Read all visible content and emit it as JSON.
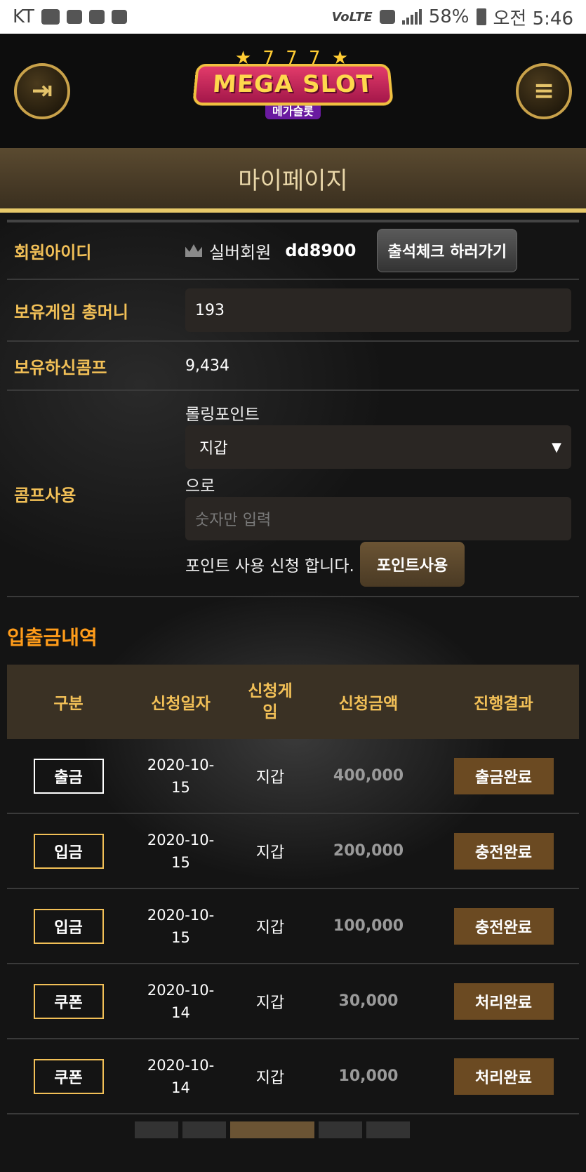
{
  "statusbar": {
    "carrier": "KT",
    "network": "VoLTE",
    "battery": "58%",
    "time": "오전 5:46"
  },
  "header": {
    "logo_title": "MEGA SLOT",
    "logo_sub": "메가슬롯",
    "login_icon": "arrow-in-icon",
    "menu_icon": "hamburger-icon"
  },
  "page_title": "마이페이지",
  "form": {
    "member_id_label": "회원아이디",
    "grade": "실버회원",
    "user_id": "dd8900",
    "attendance_button": "출석체크 하러가기",
    "money_label": "보유게임 총머니",
    "money_value": "193",
    "comp_label": "보유하신콤프",
    "comp_value": "9,434",
    "use_label": "콤프사용",
    "rolling_point": "롤링포인트",
    "wallet_select": "지갑",
    "to_text": "으로",
    "amount_placeholder": "숫자만 입력",
    "apply_text": "포인트 사용 신청 합니다.",
    "use_button": "포인트사용"
  },
  "history": {
    "title": "입출금내역",
    "headers": [
      "구분",
      "신청일자",
      "신청게임",
      "신청금액",
      "진행결과"
    ],
    "rows": [
      {
        "type": "출금",
        "date": "2020-10-15",
        "game": "지갑",
        "amount": "400,000",
        "result": "출금완료"
      },
      {
        "type": "입금",
        "date": "2020-10-15",
        "game": "지갑",
        "amount": "200,000",
        "result": "충전완료"
      },
      {
        "type": "입금",
        "date": "2020-10-15",
        "game": "지갑",
        "amount": "100,000",
        "result": "충전완료"
      },
      {
        "type": "쿠폰",
        "date": "2020-10-14",
        "game": "지갑",
        "amount": "30,000",
        "result": "처리완료"
      },
      {
        "type": "쿠폰",
        "date": "2020-10-14",
        "game": "지갑",
        "amount": "10,000",
        "result": "처리완료"
      }
    ]
  },
  "colors": {
    "accent_gold": "#f2c057",
    "section_orange": "#ff9c1a",
    "result_brown": "#6b4a22"
  }
}
